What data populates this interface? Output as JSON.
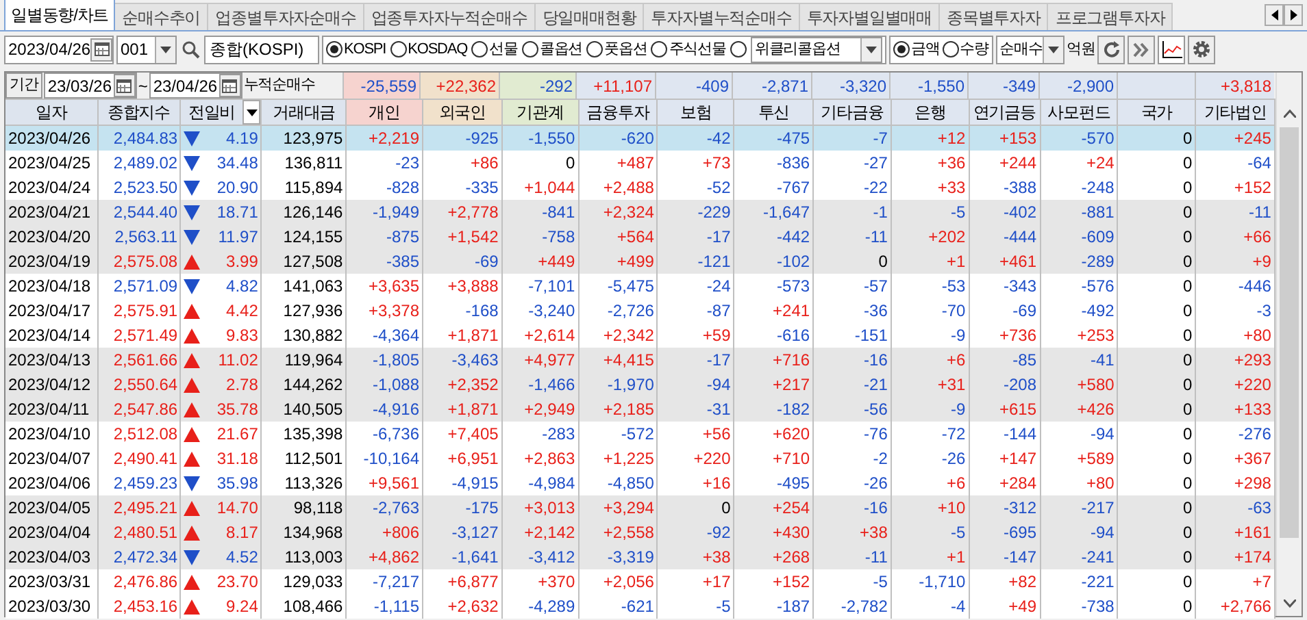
{
  "tabs": [
    {
      "label": "일별동향/차트",
      "selected": true
    },
    {
      "label": "순매수추이",
      "selected": false
    },
    {
      "label": "업종별투자자순매수",
      "selected": false
    },
    {
      "label": "업종투자자누적순매수",
      "selected": false
    },
    {
      "label": "당일매매현황",
      "selected": false
    },
    {
      "label": "투자자별누적순매수",
      "selected": false
    },
    {
      "label": "투자자별일별매매",
      "selected": false
    },
    {
      "label": "종목별투자자",
      "selected": false
    },
    {
      "label": "프로그램투자자",
      "selected": false
    }
  ],
  "toolbar": {
    "date": "2023/04/26",
    "code": "001",
    "name": "종합(KOSPI)",
    "markets": [
      {
        "label": "KOSPI",
        "selected": true
      },
      {
        "label": "KOSDAQ",
        "selected": false
      },
      {
        "label": "선물",
        "selected": false
      },
      {
        "label": "콜옵션",
        "selected": false
      },
      {
        "label": "풋옵션",
        "selected": false
      },
      {
        "label": "주식선물",
        "selected": false
      }
    ],
    "weekly_option": {
      "selected": false,
      "value": "위클리콜옵션"
    },
    "units": [
      {
        "label": "금액",
        "selected": true
      },
      {
        "label": "수량",
        "selected": false
      }
    ],
    "mode": "순매수",
    "unit_label": "억원"
  },
  "period": {
    "button": "기간",
    "from": "23/03/26",
    "separator": "~",
    "to": "23/04/26",
    "label": "누적순매수",
    "totals": [
      "-25,559",
      "+22,362",
      "-292",
      "+11,107",
      "-409",
      "-2,871",
      "-3,320",
      "-1,550",
      "-349",
      "-2,900",
      "+3,818"
    ]
  },
  "table": {
    "columns": [
      "일자",
      "종합지수",
      "전일비",
      "거래대금",
      "개인",
      "외국인",
      "기관계",
      "금융투자",
      "보험",
      "투신",
      "기타금융",
      "은행",
      "연기금등",
      "사모펀드",
      "국가",
      "기타법인"
    ],
    "rows": [
      {
        "date": "2023/04/26",
        "index": "2,484.83",
        "rising": false,
        "change": "4.19",
        "amount": "123,975",
        "values": [
          "+2,219",
          "-925",
          "-1,550",
          "-620",
          "-42",
          "-475",
          "-7",
          "+12",
          "+153",
          "-570",
          "0",
          "+245"
        ],
        "shaded": false,
        "selected": true
      },
      {
        "date": "2023/04/25",
        "index": "2,489.02",
        "rising": false,
        "change": "34.48",
        "amount": "136,811",
        "values": [
          "-23",
          "+86",
          "0",
          "+487",
          "+73",
          "-836",
          "-27",
          "+36",
          "+244",
          "+24",
          "0",
          "-64"
        ],
        "shaded": false,
        "selected": false
      },
      {
        "date": "2023/04/24",
        "index": "2,523.50",
        "rising": false,
        "change": "20.90",
        "amount": "115,894",
        "values": [
          "-828",
          "-335",
          "+1,044",
          "+2,488",
          "-52",
          "-767",
          "-22",
          "+33",
          "-388",
          "-248",
          "0",
          "+152"
        ],
        "shaded": false,
        "selected": false
      },
      {
        "date": "2023/04/21",
        "index": "2,544.40",
        "rising": false,
        "change": "18.71",
        "amount": "126,146",
        "values": [
          "-1,949",
          "+2,778",
          "-841",
          "+2,324",
          "-229",
          "-1,647",
          "-1",
          "-5",
          "-402",
          "-881",
          "0",
          "-11"
        ],
        "shaded": true,
        "selected": false
      },
      {
        "date": "2023/04/20",
        "index": "2,563.11",
        "rising": false,
        "change": "11.97",
        "amount": "124,155",
        "values": [
          "-875",
          "+1,542",
          "-758",
          "+564",
          "-17",
          "-442",
          "-11",
          "+202",
          "-444",
          "-609",
          "0",
          "+66"
        ],
        "shaded": true,
        "selected": false
      },
      {
        "date": "2023/04/19",
        "index": "2,575.08",
        "rising": true,
        "change": "3.99",
        "amount": "127,508",
        "values": [
          "-385",
          "-69",
          "+449",
          "+499",
          "-121",
          "-102",
          "0",
          "+1",
          "+461",
          "-289",
          "0",
          "+9"
        ],
        "shaded": true,
        "selected": false
      },
      {
        "date": "2023/04/18",
        "index": "2,571.09",
        "rising": false,
        "change": "4.82",
        "amount": "141,063",
        "values": [
          "+3,635",
          "+3,888",
          "-7,101",
          "-5,475",
          "-24",
          "-573",
          "-57",
          "-53",
          "-343",
          "-576",
          "0",
          "-446"
        ],
        "shaded": false,
        "selected": false
      },
      {
        "date": "2023/04/17",
        "index": "2,575.91",
        "rising": true,
        "change": "4.42",
        "amount": "127,936",
        "values": [
          "+3,378",
          "-168",
          "-3,240",
          "-2,726",
          "-87",
          "+241",
          "-36",
          "-70",
          "-69",
          "-492",
          "0",
          "-3"
        ],
        "shaded": false,
        "selected": false
      },
      {
        "date": "2023/04/14",
        "index": "2,571.49",
        "rising": true,
        "change": "9.83",
        "amount": "130,882",
        "values": [
          "-4,364",
          "+1,871",
          "+2,614",
          "+2,342",
          "+59",
          "-616",
          "-151",
          "-9",
          "+736",
          "+253",
          "0",
          "+80"
        ],
        "shaded": false,
        "selected": false
      },
      {
        "date": "2023/04/13",
        "index": "2,561.66",
        "rising": true,
        "change": "11.02",
        "amount": "119,964",
        "values": [
          "-1,805",
          "-3,463",
          "+4,977",
          "+4,415",
          "-17",
          "+716",
          "-16",
          "+6",
          "-85",
          "-41",
          "0",
          "+293"
        ],
        "shaded": true,
        "selected": false
      },
      {
        "date": "2023/04/12",
        "index": "2,550.64",
        "rising": true,
        "change": "2.78",
        "amount": "144,262",
        "values": [
          "-1,088",
          "+2,352",
          "-1,466",
          "-1,970",
          "-94",
          "+217",
          "-21",
          "+31",
          "-208",
          "+580",
          "0",
          "+220"
        ],
        "shaded": true,
        "selected": false
      },
      {
        "date": "2023/04/11",
        "index": "2,547.86",
        "rising": true,
        "change": "35.78",
        "amount": "140,505",
        "values": [
          "-4,916",
          "+1,871",
          "+2,949",
          "+2,185",
          "-31",
          "-182",
          "-56",
          "-9",
          "+615",
          "+426",
          "0",
          "+133"
        ],
        "shaded": true,
        "selected": false
      },
      {
        "date": "2023/04/10",
        "index": "2,512.08",
        "rising": true,
        "change": "21.67",
        "amount": "135,398",
        "values": [
          "-6,736",
          "+7,405",
          "-283",
          "-572",
          "+56",
          "+620",
          "-76",
          "-72",
          "-144",
          "-94",
          "0",
          "-276"
        ],
        "shaded": false,
        "selected": false
      },
      {
        "date": "2023/04/07",
        "index": "2,490.41",
        "rising": true,
        "change": "31.18",
        "amount": "112,501",
        "values": [
          "-10,164",
          "+6,951",
          "+2,863",
          "+1,225",
          "+220",
          "+710",
          "-2",
          "-26",
          "+147",
          "+589",
          "0",
          "+367"
        ],
        "shaded": false,
        "selected": false
      },
      {
        "date": "2023/04/06",
        "index": "2,459.23",
        "rising": false,
        "change": "35.98",
        "amount": "113,326",
        "values": [
          "+9,561",
          "-4,915",
          "-4,984",
          "-4,850",
          "+16",
          "-495",
          "-26",
          "+6",
          "+284",
          "+80",
          "0",
          "+298"
        ],
        "shaded": false,
        "selected": false
      },
      {
        "date": "2023/04/05",
        "index": "2,495.21",
        "rising": true,
        "change": "14.70",
        "amount": "98,118",
        "values": [
          "-2,763",
          "-175",
          "+3,013",
          "+3,294",
          "0",
          "+254",
          "-16",
          "+10",
          "-312",
          "-217",
          "0",
          "-63"
        ],
        "shaded": true,
        "selected": false
      },
      {
        "date": "2023/04/04",
        "index": "2,480.51",
        "rising": true,
        "change": "8.17",
        "amount": "134,968",
        "values": [
          "+806",
          "-3,127",
          "+2,142",
          "+2,558",
          "-92",
          "+430",
          "+38",
          "-5",
          "-695",
          "-94",
          "0",
          "+161"
        ],
        "shaded": true,
        "selected": false
      },
      {
        "date": "2023/04/03",
        "index": "2,472.34",
        "rising": false,
        "change": "4.52",
        "amount": "113,003",
        "values": [
          "+4,862",
          "-1,641",
          "-3,412",
          "-3,319",
          "+38",
          "+268",
          "-11",
          "+1",
          "-147",
          "-241",
          "0",
          "+174"
        ],
        "shaded": true,
        "selected": false
      },
      {
        "date": "2023/03/31",
        "index": "2,476.86",
        "rising": true,
        "change": "23.70",
        "amount": "129,033",
        "values": [
          "-7,217",
          "+6,877",
          "+370",
          "+2,056",
          "+17",
          "+152",
          "-5",
          "-1,710",
          "+82",
          "-221",
          "0",
          "+7"
        ],
        "shaded": false,
        "selected": false
      },
      {
        "date": "2023/03/30",
        "index": "2,453.16",
        "rising": true,
        "change": "9.24",
        "amount": "108,466",
        "values": [
          "-1,115",
          "+2,632",
          "-4,289",
          "-621",
          "-5",
          "-187",
          "-2,782",
          "-4",
          "+49",
          "-738",
          "0",
          "+2,766"
        ],
        "shaded": false,
        "selected": false
      }
    ]
  }
}
